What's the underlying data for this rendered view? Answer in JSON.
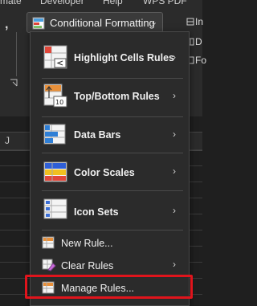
{
  "menubar": [
    "mate",
    "Developer",
    "Help",
    "WPS PDF"
  ],
  "ribbon": {
    "cf_button_label": "Conditional Formatting",
    "right_items": [
      "In",
      "D",
      "Fo"
    ]
  },
  "grid": {
    "column_label": "J"
  },
  "menu": {
    "items": [
      {
        "label": "Highlight Cells Rules",
        "has_submenu": true
      },
      {
        "label": "Top/Bottom Rules",
        "has_submenu": true
      },
      {
        "label": "Data Bars",
        "has_submenu": true
      },
      {
        "label": "Color Scales",
        "has_submenu": true
      },
      {
        "label": "Icon Sets",
        "has_submenu": true
      }
    ],
    "small_items": [
      {
        "label": "New Rule...",
        "has_submenu": false
      },
      {
        "label": "Clear Rules",
        "has_submenu": true
      },
      {
        "label": "Manage Rules...",
        "has_submenu": false
      }
    ],
    "highlighted_item": "Manage Rules...",
    "highlight_color": "#e0141c"
  }
}
